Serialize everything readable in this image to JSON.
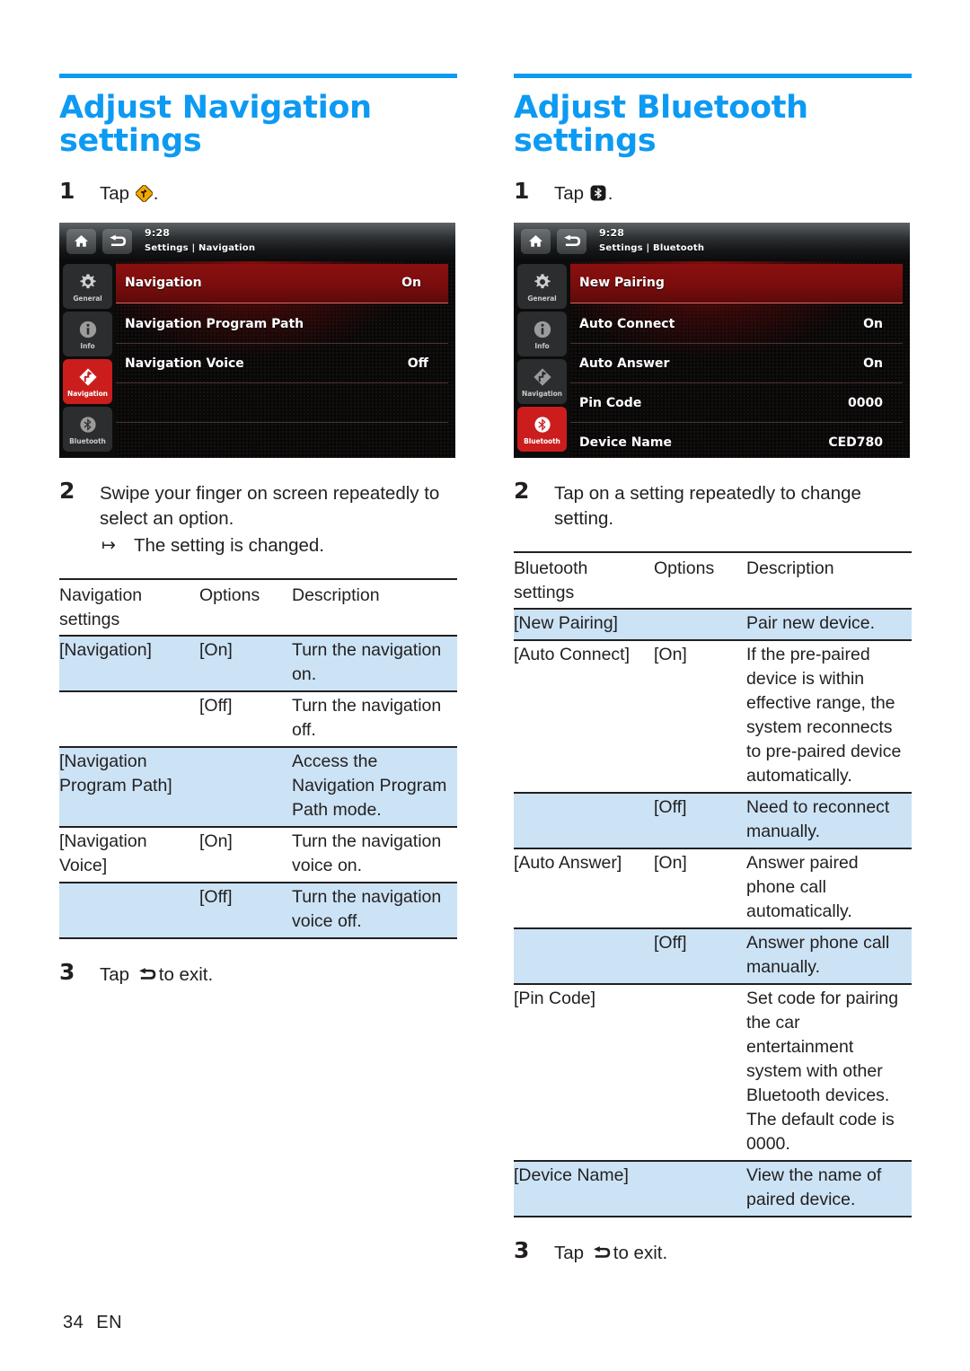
{
  "page": {
    "folio_number": "34",
    "folio_language": "EN",
    "accent_color": "#0D9AF2",
    "highlight_row_color": "#cbe3f5"
  },
  "columns": [
    {
      "id": "navigation",
      "title": "Adjust Navigation settings",
      "steps": {
        "one": {
          "num": "1",
          "text_before": "Tap",
          "icon": "navigation-sign-icon",
          "text_after": "."
        },
        "two": {
          "num": "2",
          "text": "Swipe your finger on screen repeatedly to select an option.",
          "substep_arrow": "↦",
          "substep_text": "The setting is changed."
        },
        "three": {
          "num": "3",
          "text_before": "Tap",
          "icon": "back-arrow-icon",
          "text_after": "to exit."
        }
      },
      "device": {
        "clock": "9:28",
        "breadcrumb": "Settings | Navigation",
        "home_icon": "home-icon",
        "back_icon": "back-arrow-icon",
        "sidebar": [
          {
            "label": "General",
            "icon": "gear-icon",
            "active": false
          },
          {
            "label": "Info",
            "icon": "info-icon",
            "active": false
          },
          {
            "label": "Navigation",
            "icon": "navigation-arrow-icon",
            "active": true
          },
          {
            "label": "Bluetooth",
            "icon": "bluetooth-icon",
            "active": false
          }
        ],
        "rows": [
          {
            "label": "Navigation",
            "value": "On",
            "selected": true
          },
          {
            "label": "Navigation Program Path",
            "value": "",
            "selected": false
          },
          {
            "label": "Navigation Voice",
            "value": "Off",
            "selected": false
          },
          {
            "label": "",
            "value": "",
            "selected": false
          },
          {
            "label": "",
            "value": "",
            "selected": false
          }
        ]
      },
      "table": {
        "headers": [
          "Navigation settings",
          "Options",
          "Description"
        ],
        "rows": [
          {
            "setting": "[Navigation]",
            "option": "[On]",
            "description": "Turn the navigation on.",
            "shaded": true
          },
          {
            "setting": "",
            "option": "[Off]",
            "description": "Turn the navigation off.",
            "shaded": false
          },
          {
            "setting": "[Navigation Program Path]",
            "option": "",
            "description": "Access the Navigation Program Path mode.",
            "shaded": true
          },
          {
            "setting": "[Navigation Voice]",
            "option": "[On]",
            "description": "Turn the navigation voice on.",
            "shaded": false
          },
          {
            "setting": "",
            "option": "[Off]",
            "description": "Turn the navigation voice off.",
            "shaded": true
          }
        ]
      }
    },
    {
      "id": "bluetooth",
      "title": "Adjust Bluetooth settings",
      "steps": {
        "one": {
          "num": "1",
          "text_before": "Tap",
          "icon": "bluetooth-badge-icon",
          "text_after": "."
        },
        "two": {
          "num": "2",
          "text": "Tap on a setting repeatedly to change setting.",
          "substep_arrow": "",
          "substep_text": ""
        },
        "three": {
          "num": "3",
          "text_before": "Tap",
          "icon": "back-arrow-icon",
          "text_after": "to exit."
        }
      },
      "device": {
        "clock": "9:28",
        "breadcrumb": "Settings | Bluetooth",
        "home_icon": "home-icon",
        "back_icon": "back-arrow-icon",
        "sidebar": [
          {
            "label": "General",
            "icon": "gear-icon",
            "active": false
          },
          {
            "label": "Info",
            "icon": "info-icon",
            "active": false
          },
          {
            "label": "Navigation",
            "icon": "navigation-arrow-icon",
            "active": false
          },
          {
            "label": "Bluetooth",
            "icon": "bluetooth-icon",
            "active": true
          }
        ],
        "rows": [
          {
            "label": "New Pairing",
            "value": "",
            "selected": true
          },
          {
            "label": "Auto Connect",
            "value": "On",
            "selected": false
          },
          {
            "label": "Auto Answer",
            "value": "On",
            "selected": false
          },
          {
            "label": "Pin Code",
            "value": "0000",
            "selected": false
          },
          {
            "label": "Device Name",
            "value": "CED780",
            "selected": false
          }
        ]
      },
      "table": {
        "headers": [
          "Bluetooth settings",
          "Options",
          "Description"
        ],
        "rows": [
          {
            "setting": "[New Pairing]",
            "option": "",
            "description": "Pair new device.",
            "shaded": true
          },
          {
            "setting": "[Auto Connect]",
            "option": "[On]",
            "description": "If the pre-paired device is within effective range, the system reconnects to pre-paired device automatically.",
            "shaded": false
          },
          {
            "setting": "",
            "option": "[Off]",
            "description": "Need to reconnect manually.",
            "shaded": true
          },
          {
            "setting": "[Auto Answer]",
            "option": "[On]",
            "description": "Answer paired phone call automatically.",
            "shaded": false
          },
          {
            "setting": "",
            "option": "[Off]",
            "description": "Answer phone call manually.",
            "shaded": true
          },
          {
            "setting": "[Pin Code]",
            "option": "",
            "description": "Set code for pairing the car entertainment system with other Bluetooth devices. The default code is 0000.",
            "shaded": false
          },
          {
            "setting": "[Device Name]",
            "option": "",
            "description": "View the name of paired device.",
            "shaded": true
          }
        ]
      }
    }
  ]
}
